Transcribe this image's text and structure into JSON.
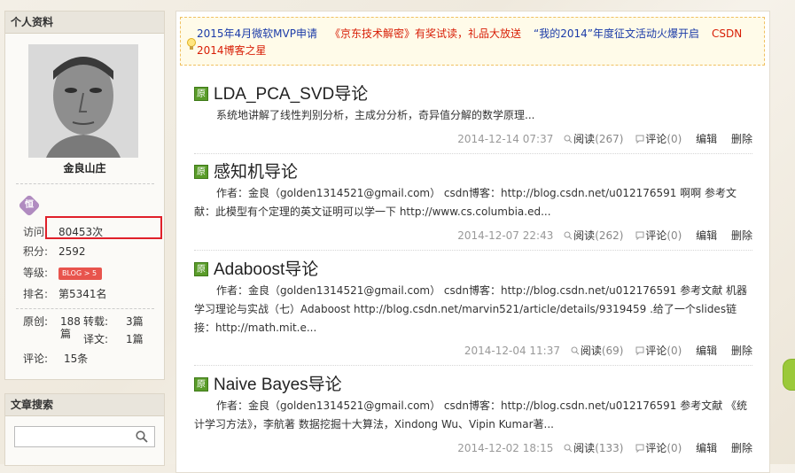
{
  "profile": {
    "section_title": "个人资料",
    "user_name": "金良山庄",
    "medal_icon": "medal-icon",
    "visits_label": "访问:",
    "visits_value": "80453次",
    "points_label": "积分:",
    "points_value": "2592",
    "level_label": "等级:",
    "level_badge": "BLOG",
    "level_value": "5",
    "rank_label": "排名:",
    "rank_value": "第5341名",
    "original_label": "原创:",
    "original_value": "188篇",
    "repost_label": "转载:",
    "repost_value": "3篇",
    "translation_label": "译文:",
    "translation_value": "1篇",
    "comments_label": "评论:",
    "comments_value": "15条"
  },
  "search": {
    "section_title": "文章搜索",
    "placeholder": "",
    "value": ""
  },
  "notice": {
    "line1": [
      "2015年4月微软MVP申请",
      "《京东技术解密》有奖试读，礼品大放送",
      "“我的2014”年度征文活动火爆开启",
      "CSDN"
    ],
    "line2": "2014博客之星"
  },
  "articles": [
    {
      "tag": "原",
      "title": "LDA_PCA_SVD导论",
      "summary": "系统地讲解了线性判别分析，主成分分析，奇异值分解的数学原理...",
      "date": "2014-12-14 07:37",
      "read_label": "阅读",
      "read_count": "(267)",
      "comment_label": "评论",
      "comment_count": "(0)",
      "edit_label": "编辑",
      "delete_label": "删除"
    },
    {
      "tag": "原",
      "title": "感知机导论",
      "summary": "作者：金良（golden1314521@gmail.com） csdn博客：http://blog.csdn.net/u012176591 啊啊 参考文献：此模型有个定理的英文证明可以学一下 http://www.cs.columbia.ed...",
      "date": "2014-12-07 22:43",
      "read_label": "阅读",
      "read_count": "(262)",
      "comment_label": "评论",
      "comment_count": "(0)",
      "edit_label": "编辑",
      "delete_label": "删除"
    },
    {
      "tag": "原",
      "title": "Adaboost导论",
      "summary": "作者：金良（golden1314521@gmail.com） csdn博客：http://blog.csdn.net/u012176591 参考文献 机器学习理论与实战（七）Adaboost http://blog.csdn.net/marvin521/article/details/9319459 .给了一个slides链接：http://math.mit.e...",
      "date": "2014-12-04 11:37",
      "read_label": "阅读",
      "read_count": "(69)",
      "comment_label": "评论",
      "comment_count": "(0)",
      "edit_label": "编辑",
      "delete_label": "删除"
    },
    {
      "tag": "原",
      "title": "Naive Bayes导论",
      "summary": "作者：金良（golden1314521@gmail.com） csdn博客：http://blog.csdn.net/u012176591 参考文献 《统计学习方法》，李航著 数据挖掘十大算法，Xindong Wu、Vipin Kumar著...",
      "date": "2014-12-02 18:15",
      "read_label": "阅读",
      "read_count": "(133)",
      "comment_label": "评论",
      "comment_count": "(0)",
      "edit_label": "编辑",
      "delete_label": "删除"
    }
  ],
  "colors": {
    "highlight": "#e0202a",
    "orig_tag": "#5a9c2a",
    "notice_blue": "#1a3aa8",
    "notice_red": "#d81e06"
  }
}
